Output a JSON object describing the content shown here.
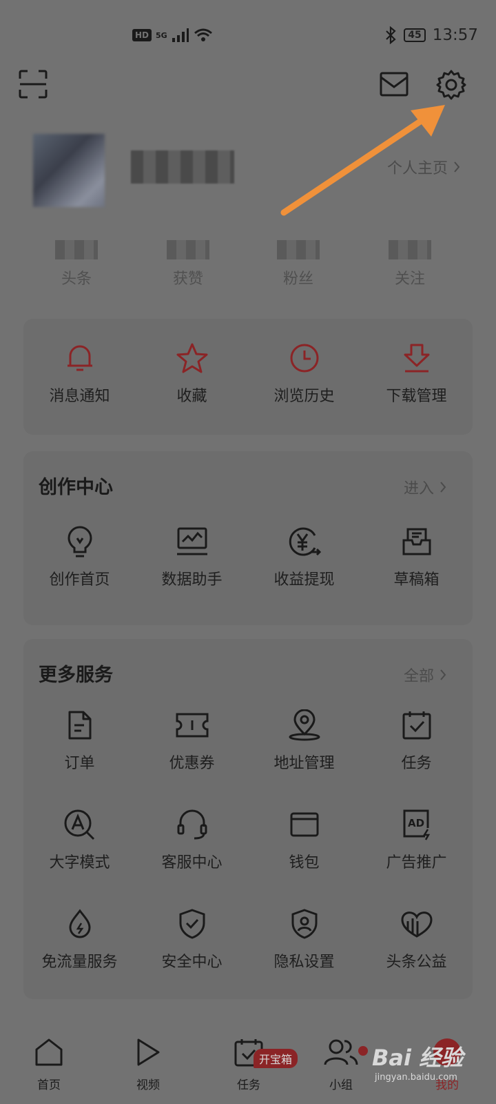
{
  "status_bar": {
    "time": "13:57",
    "battery": "45",
    "network": "5G",
    "hd": "HD"
  },
  "header": {
    "scan_icon": "scan-icon",
    "mail_icon": "mail-icon",
    "settings_icon": "gear-icon"
  },
  "profile": {
    "homepage_label": "个人主页"
  },
  "stats": [
    {
      "label": "头条"
    },
    {
      "label": "获赞"
    },
    {
      "label": "粉丝"
    },
    {
      "label": "关注"
    }
  ],
  "quick_actions": [
    {
      "label": "消息通知",
      "icon": "bell-icon"
    },
    {
      "label": "收藏",
      "icon": "star-icon"
    },
    {
      "label": "浏览历史",
      "icon": "clock-icon"
    },
    {
      "label": "下载管理",
      "icon": "download-icon"
    }
  ],
  "creation_center": {
    "title": "创作中心",
    "link": "进入",
    "items": [
      {
        "label": "创作首页",
        "icon": "lightbulb-icon"
      },
      {
        "label": "数据助手",
        "icon": "chart-monitor-icon"
      },
      {
        "label": "收益提现",
        "icon": "yuan-icon"
      },
      {
        "label": "草稿箱",
        "icon": "draft-box-icon"
      }
    ]
  },
  "more_services": {
    "title": "更多服务",
    "link": "全部",
    "items": [
      {
        "label": "订单",
        "icon": "document-icon"
      },
      {
        "label": "优惠券",
        "icon": "ticket-icon"
      },
      {
        "label": "地址管理",
        "icon": "location-pin-icon"
      },
      {
        "label": "任务",
        "icon": "calendar-check-icon"
      },
      {
        "label": "大字模式",
        "icon": "font-size-icon"
      },
      {
        "label": "客服中心",
        "icon": "headset-icon"
      },
      {
        "label": "钱包",
        "icon": "wallet-icon"
      },
      {
        "label": "广告推广",
        "icon": "ad-icon"
      },
      {
        "label": "免流量服务",
        "icon": "flame-icon"
      },
      {
        "label": "安全中心",
        "icon": "shield-check-icon"
      },
      {
        "label": "隐私设置",
        "icon": "shield-user-icon"
      },
      {
        "label": "头条公益",
        "icon": "charity-icon"
      }
    ]
  },
  "tabbar": {
    "tabs": [
      {
        "label": "首页",
        "icon": "home-icon"
      },
      {
        "label": "视频",
        "icon": "play-icon"
      },
      {
        "label": "任务",
        "icon": "task-icon"
      },
      {
        "label": "小组",
        "icon": "group-icon"
      },
      {
        "label": "我的",
        "icon": "profile-icon"
      }
    ],
    "task_badge": "开宝箱"
  },
  "watermark": {
    "brand": "Bai 经验",
    "url": "jingyan.baidu.com"
  },
  "colors": {
    "background": "#727272",
    "accent_red": "#8b2426",
    "arrow": "#f0913a"
  }
}
